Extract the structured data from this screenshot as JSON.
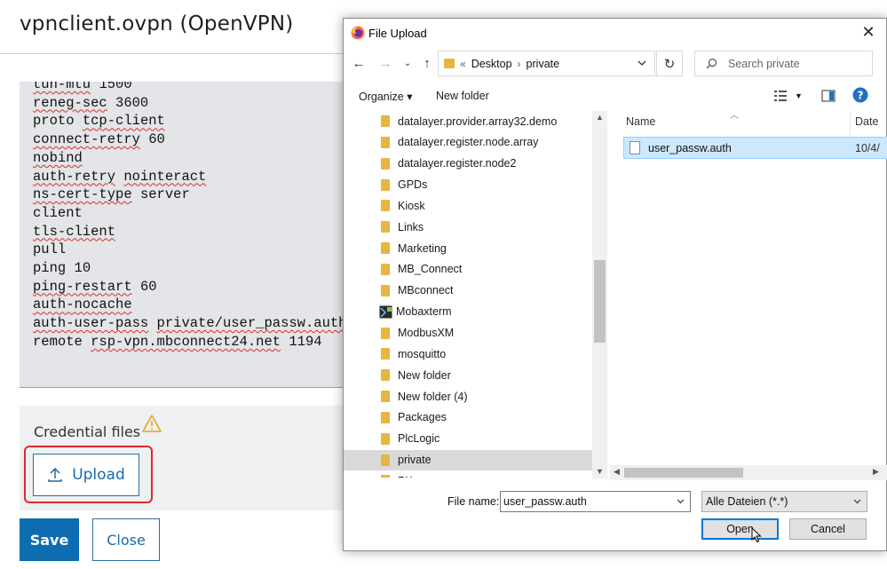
{
  "page": {
    "title": "vpnclient.ovpn (OpenVPN)",
    "config_lines": [
      "tun-mtu 1500",
      "reneg-sec 3600",
      "proto tcp-client",
      "connect-retry 60",
      "nobind",
      "auth-retry nointeract",
      "ns-cert-type server",
      "client",
      "tls-client",
      "pull",
      "ping 10",
      "ping-restart 60",
      "auth-nocache",
      "auth-user-pass private/user_passw.auth",
      "remote rsp-vpn.mbconnect24.net 1194"
    ],
    "credential_label": "Credential files",
    "upload_label": "Upload",
    "save_label": "Save",
    "close_label": "Close",
    "colors": {
      "primary": "#0d6db0",
      "highlight": "#e0282e",
      "warning": "#e8a317"
    }
  },
  "dialog": {
    "title": "File Upload",
    "breadcrumb": {
      "overflow": "«",
      "items": [
        "Desktop",
        "private"
      ]
    },
    "search_placeholder": "Search private",
    "toolbar": {
      "organize": "Organize",
      "new_folder": "New folder"
    },
    "tree": [
      {
        "label": "datalayer.provider.array32.demo",
        "icon": "folder-icon"
      },
      {
        "label": "datalayer.register.node.array",
        "icon": "folder-icon"
      },
      {
        "label": "datalayer.register.node2",
        "icon": "folder-icon"
      },
      {
        "label": "GPDs",
        "icon": "folder-icon"
      },
      {
        "label": "Kiosk",
        "icon": "folder-icon"
      },
      {
        "label": "Links",
        "icon": "folder-icon"
      },
      {
        "label": "Marketing",
        "icon": "folder-icon"
      },
      {
        "label": "MB_Connect",
        "icon": "folder-icon"
      },
      {
        "label": "MBconnect",
        "icon": "folder-icon"
      },
      {
        "label": "Mobaxterm",
        "icon": "mobaxterm-app-icon"
      },
      {
        "label": "ModbusXM",
        "icon": "folder-icon"
      },
      {
        "label": "mosquitto",
        "icon": "folder-icon"
      },
      {
        "label": "New folder",
        "icon": "folder-icon"
      },
      {
        "label": "New folder (4)",
        "icon": "folder-icon"
      },
      {
        "label": "Packages",
        "icon": "folder-icon"
      },
      {
        "label": "PlcLogic",
        "icon": "folder-icon"
      },
      {
        "label": "private",
        "icon": "folder-icon",
        "selected": true
      },
      {
        "label": "PXproxy",
        "icon": "folder-icon"
      }
    ],
    "columns": {
      "name": "Name",
      "date": "Date"
    },
    "files": [
      {
        "name": "user_passw.auth",
        "date": "10/4/"
      }
    ],
    "file_name_label": "File name:",
    "file_name_value": "user_passw.auth",
    "file_type_value": "Alle Dateien (*.*)",
    "open_label": "Open",
    "cancel_label": "Cancel"
  }
}
